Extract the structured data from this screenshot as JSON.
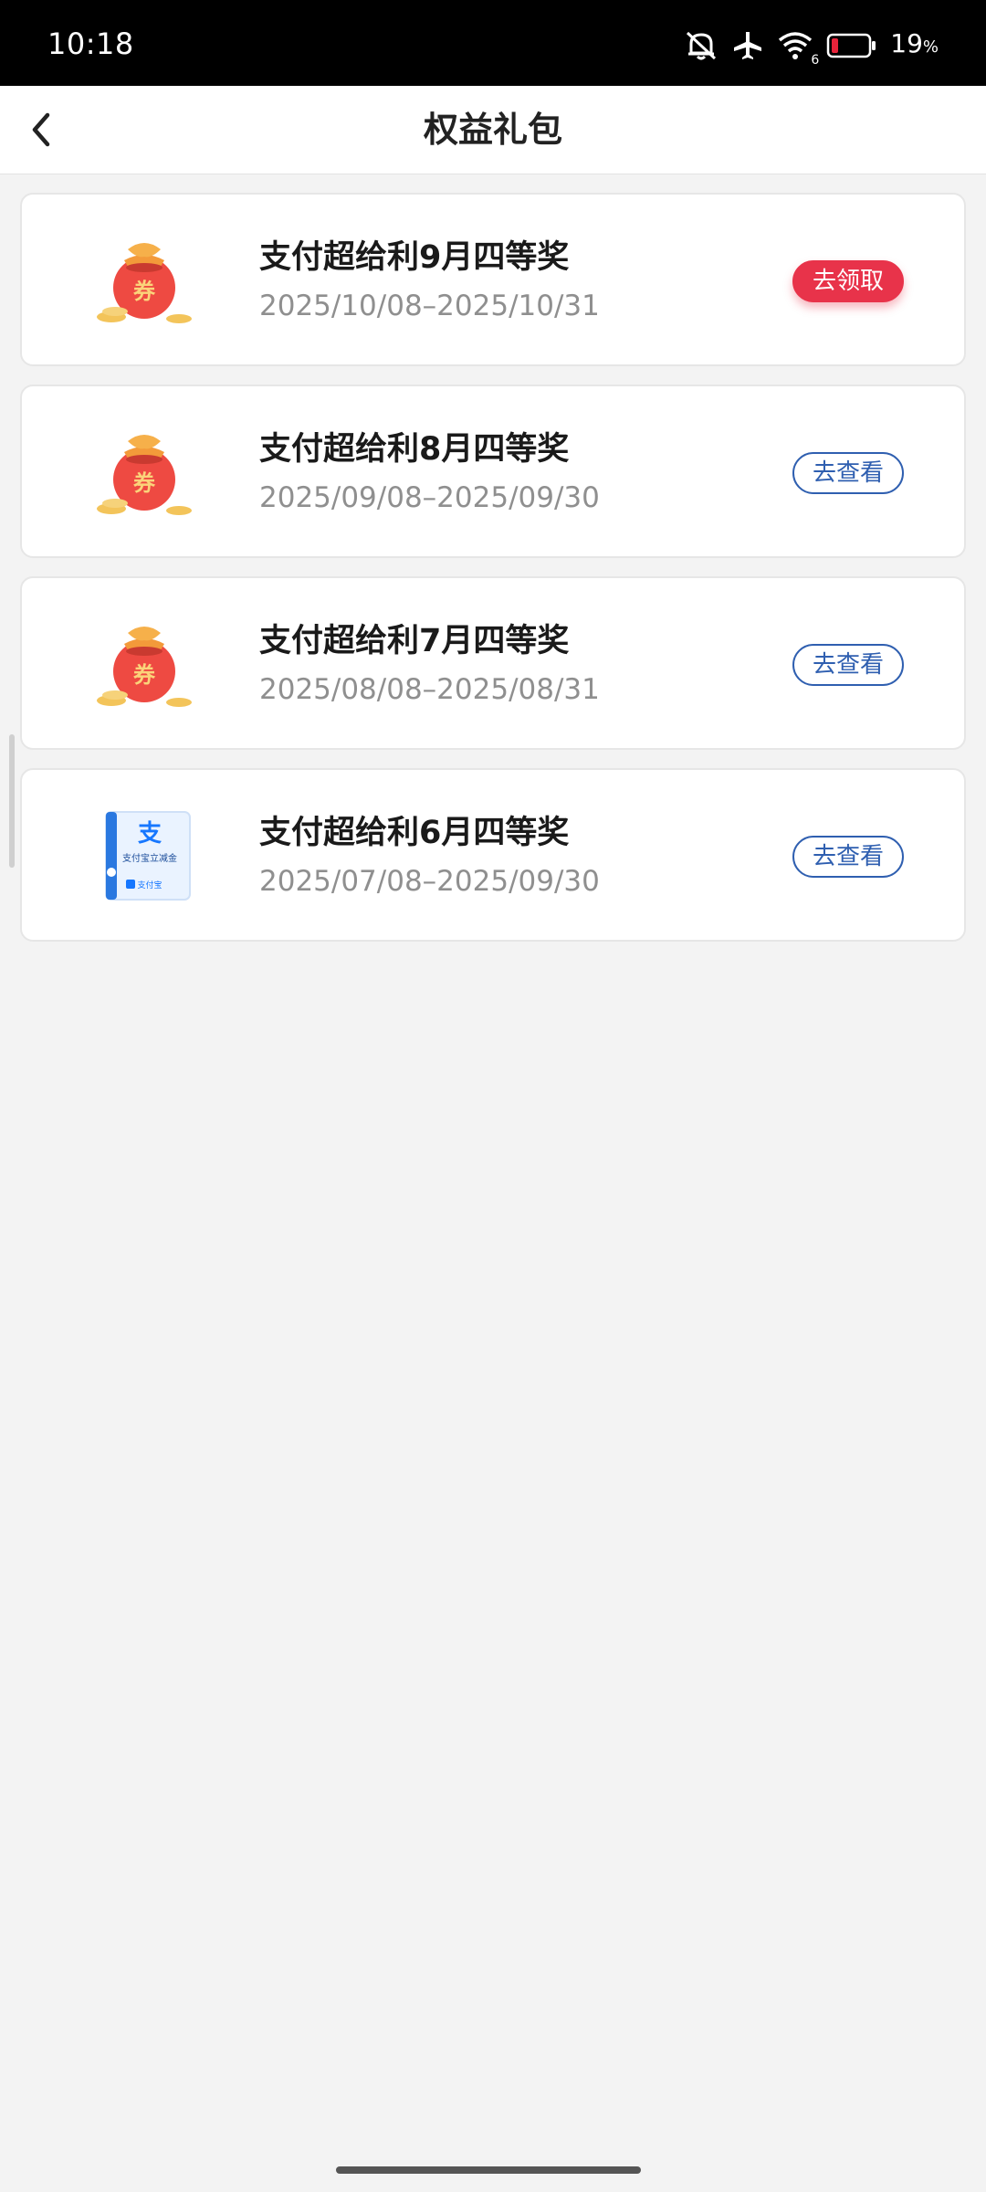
{
  "status_bar": {
    "time": "10:18",
    "battery_percent": "19",
    "battery_unit": "%",
    "network_label": "6",
    "battery_level": 0.19
  },
  "nav": {
    "title": "权益礼包",
    "back_icon": "chevron-left-icon"
  },
  "items": [
    {
      "title": "支付超给利9月四等奖",
      "date": "2025/10/08–2025/10/31",
      "button": "去领取",
      "icon": "coupon-bag-icon"
    },
    {
      "title": "支付超给利8月四等奖",
      "date": "2025/09/08–2025/09/30",
      "button": "去查看",
      "icon": "coupon-bag-icon"
    },
    {
      "title": "支付超给利7月四等奖",
      "date": "2025/08/08–2025/08/31",
      "button": "去查看",
      "icon": "coupon-bag-icon"
    },
    {
      "title": "支付超给利6月四等奖",
      "date": "2025/07/08–2025/09/30",
      "button": "去查看",
      "icon": "alipay-voucher-icon",
      "voucher_symbol": "支",
      "voucher_text": "支付宝立减金",
      "voucher_footer": "支付宝"
    }
  ],
  "coupon_bag_text": "券",
  "colors": {
    "claim": "#e8334a",
    "view": "#2f5fb0",
    "background": "#f3f3f3"
  }
}
